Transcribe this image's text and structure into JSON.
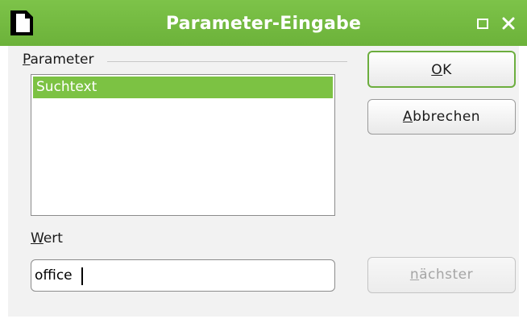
{
  "window": {
    "title": "Parameter-Eingabe"
  },
  "icons": {
    "app": "document-icon",
    "maximize": "maximize-icon",
    "close": "close-icon"
  },
  "colors": {
    "titlebar": "#6cb23a",
    "selection": "#7cc243",
    "ok_border": "#6cae3e"
  },
  "parameter_group": {
    "label_mnemonic": "P",
    "label_rest": "arameter",
    "items": [
      "Suchtext"
    ],
    "selected_index": 0
  },
  "value_group": {
    "label_mnemonic": "W",
    "label_rest": "ert",
    "value": "office"
  },
  "buttons": {
    "ok_mnemonic": "O",
    "ok_rest": "K",
    "cancel_mnemonic": "A",
    "cancel_rest": "bbrechen",
    "next_prefix": "",
    "next_mnemonic": "n",
    "next_rest": "ächster",
    "next_enabled": false
  }
}
